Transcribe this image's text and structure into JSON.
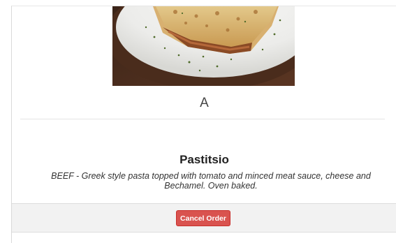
{
  "order": {
    "table_label": "A",
    "dish_name": "Pastitsio",
    "dish_description": "BEEF - Greek style pasta topped with tomato and minced meat sauce, cheese and Bechamel. Oven baked.",
    "cancel_label": "Cancel Order"
  },
  "colors": {
    "cancel_button": "#d9534f",
    "footer_bg": "#f2f2f2"
  }
}
